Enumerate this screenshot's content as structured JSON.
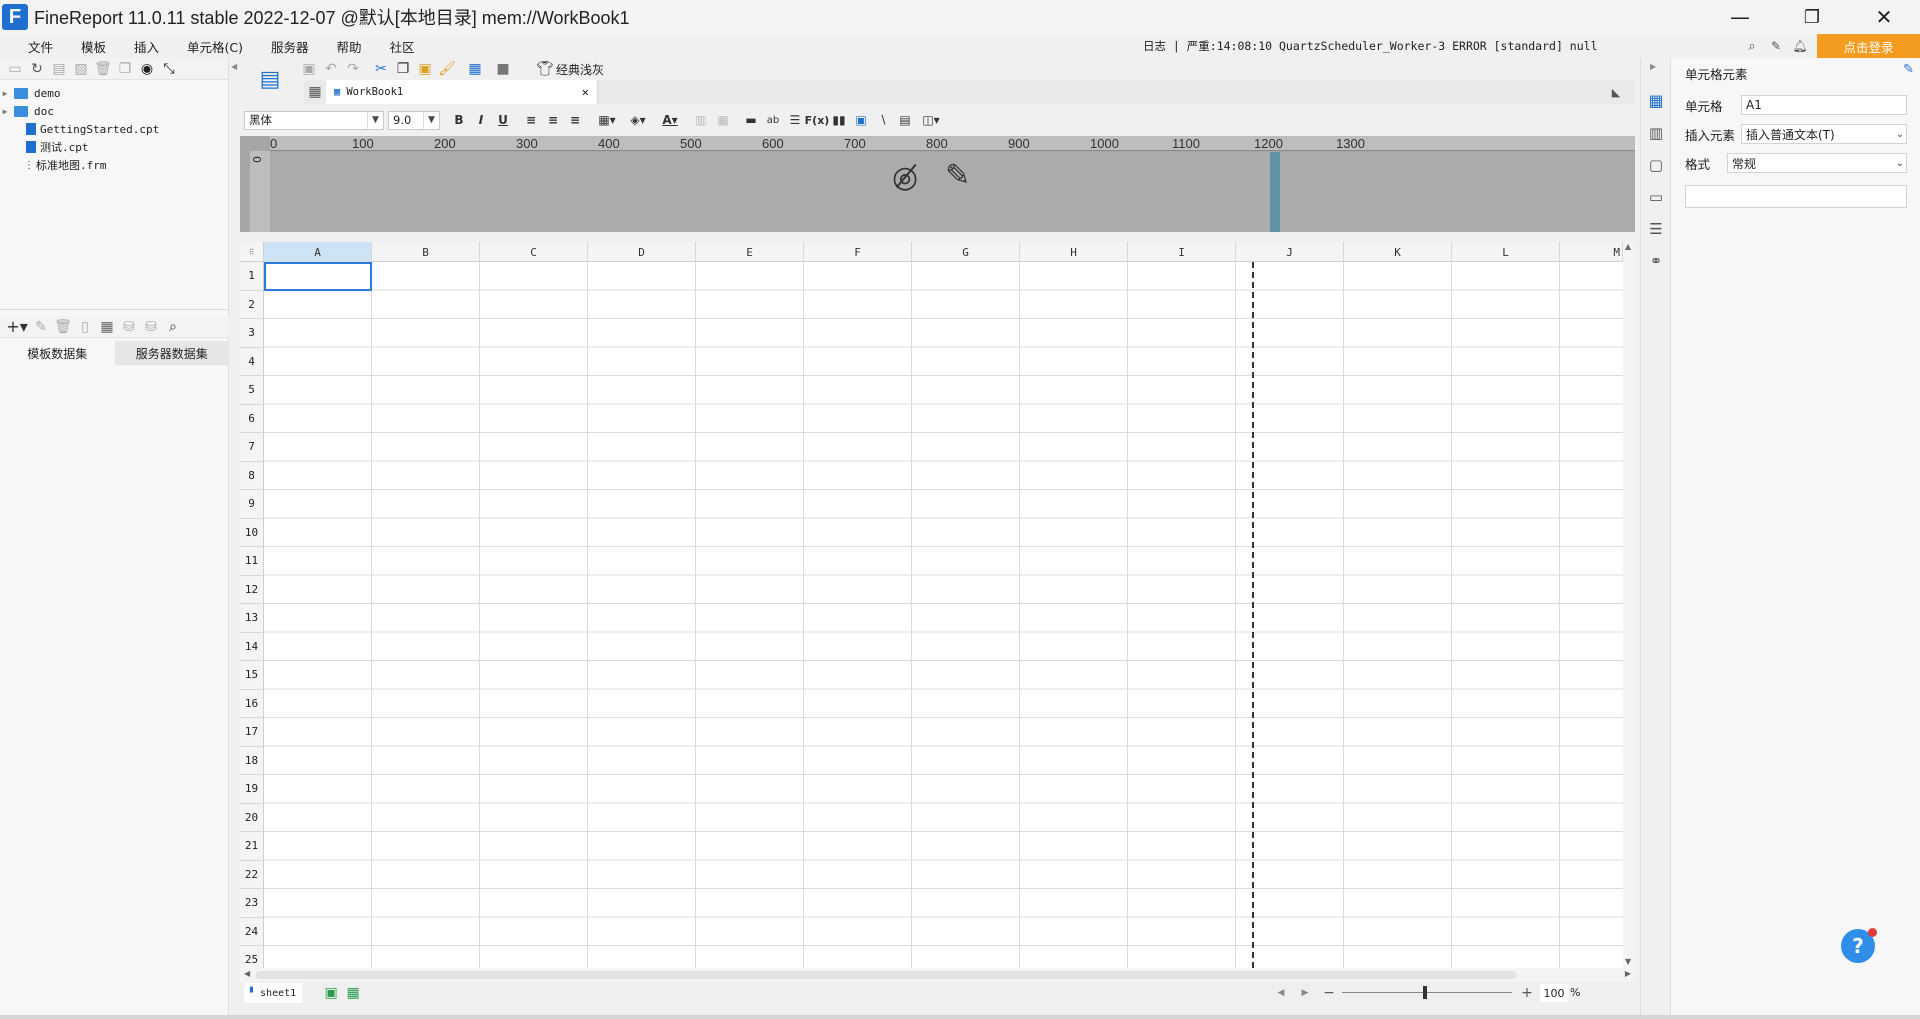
{
  "window": {
    "title": "FineReport 11.0.11 stable 2022-12-07 @默认[本地目录]    mem://WorkBook1",
    "logo_letter": "F",
    "minimize": "—",
    "maximize": "❐",
    "close": "✕"
  },
  "menu": {
    "items": [
      "文件",
      "模板",
      "插入",
      "单元格(C)",
      "服务器",
      "帮助",
      "社区"
    ],
    "log": "日志 | 严重:14:08:10 QuartzScheduler_Worker-3 ERROR [standard] null",
    "login_label": "点击登录"
  },
  "tree": {
    "items": [
      {
        "label": "demo",
        "type": "folder"
      },
      {
        "label": "doc",
        "type": "folder"
      },
      {
        "label": "GettingStarted.cpt",
        "type": "file"
      },
      {
        "label": "测试.cpt",
        "type": "file"
      },
      {
        "label": "标准地图.frm",
        "type": "file"
      }
    ]
  },
  "dataset_tabs": {
    "template": "模板数据集",
    "server": "服务器数据集"
  },
  "toolbar": {
    "theme_label": "经典浅灰",
    "doc_tab": "WorkBook1",
    "font_name": "黑体",
    "font_size": "9.0"
  },
  "ruler": {
    "labels": [
      "0",
      "100",
      "200",
      "300",
      "400",
      "500",
      "600",
      "700",
      "800",
      "900",
      "1000",
      "1100",
      "1200",
      "1300"
    ]
  },
  "sheet": {
    "columns": [
      "A",
      "B",
      "C",
      "D",
      "E",
      "F",
      "G",
      "H",
      "I",
      "J",
      "K",
      "L",
      "M"
    ],
    "rows": [
      "1",
      "2",
      "3",
      "4",
      "5",
      "6",
      "7",
      "8",
      "9",
      "10",
      "11",
      "12",
      "13",
      "14",
      "15",
      "16",
      "17",
      "18",
      "19",
      "20",
      "21",
      "22",
      "23",
      "24",
      "25"
    ],
    "tab": "sheet1",
    "zoom": "100",
    "zoom_unit": "%"
  },
  "right_panel": {
    "title": "单元格元素",
    "cell_label": "单元格",
    "cell_value": "A1",
    "insert_label": "插入元素",
    "insert_value": "插入普通文本(T)",
    "format_label": "格式",
    "format_value": "常规"
  },
  "help": {
    "label": "?"
  }
}
